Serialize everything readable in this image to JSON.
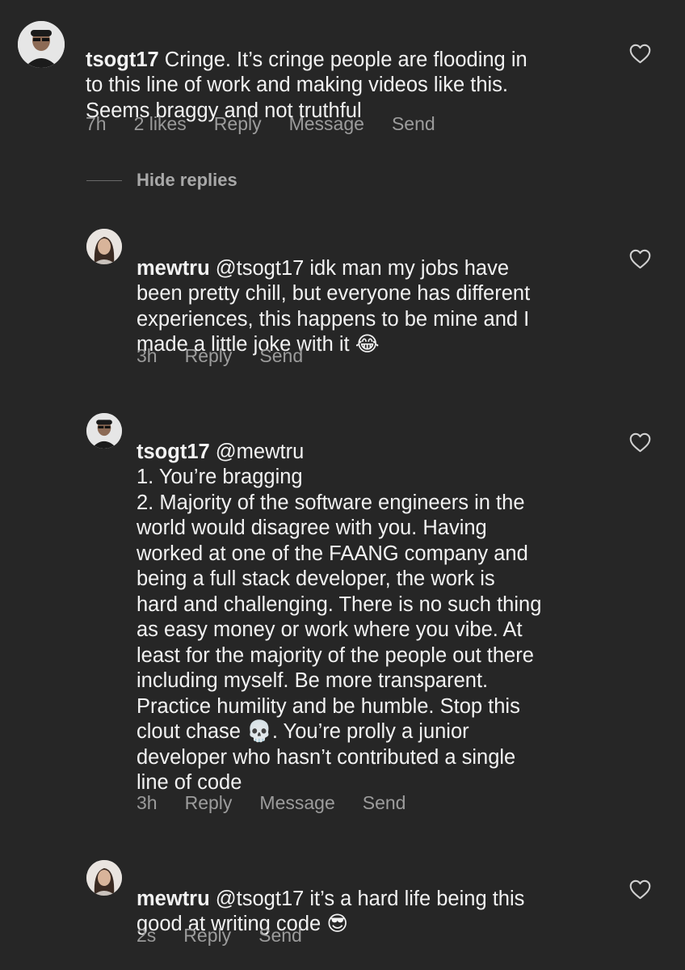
{
  "comments": [
    {
      "username": "tsogt17",
      "body": " Cringe. It’s cringe people are flooding in\nto this line of work and making videos like this.\nSeems braggy and not truthful",
      "time": "7h",
      "likes": "2 likes",
      "actions": [
        "Reply",
        "Message",
        "Send"
      ]
    }
  ],
  "hide_replies_label": "Hide replies",
  "replies": [
    {
      "username": "mewtru",
      "body": " @tsogt17 idk man my jobs have\nbeen pretty chill, but everyone has different\nexperiences, this happens to be mine and I\nmade a little joke with it 😂",
      "time": "3h",
      "actions": [
        "Reply",
        "Send"
      ]
    },
    {
      "username": "tsogt17",
      "body": " @mewtru\n1. You’re bragging\n2. Majority of the software engineers in the\nworld would disagree with you. Having\nworked at one of the FAANG company and\nbeing a full stack developer, the work is\nhard and challenging. There is no such thing\nas easy money or work where you vibe. At\nleast for the majority of the people out there\nincluding myself. Be more transparent.\nPractice humility and be humble. Stop this\nclout chase 💀. You’re prolly a junior\ndeveloper who hasn’t contributed a single\nline of code",
      "time": "3h",
      "actions": [
        "Reply",
        "Message",
        "Send"
      ]
    },
    {
      "username": "mewtru",
      "body": " @tsogt17 it’s a hard life being this\ngood at writing code 😎",
      "time": "2s",
      "actions": [
        "Reply",
        "Send"
      ]
    }
  ],
  "icons": {
    "like": "heart-outline-icon"
  },
  "colors": {
    "background": "#262626",
    "primary_text": "#f2f2f2",
    "secondary_text": "#9a9a9a"
  }
}
